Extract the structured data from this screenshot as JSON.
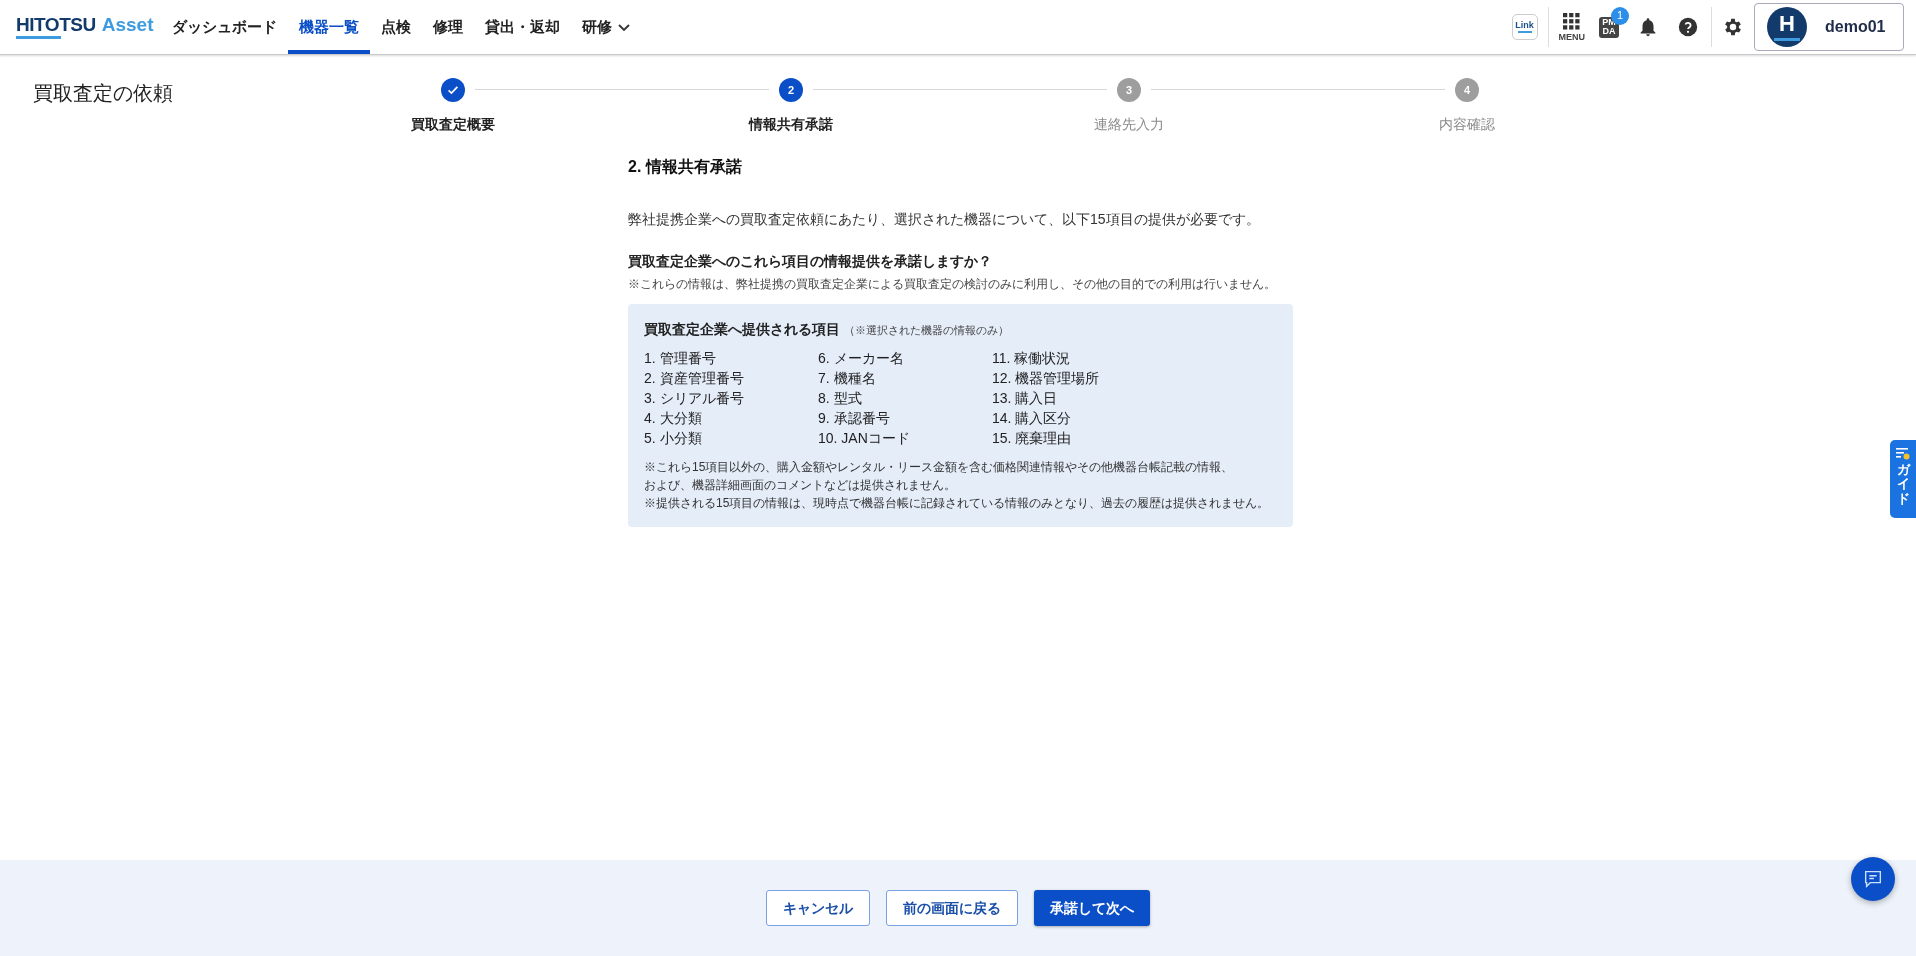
{
  "header": {
    "logo": {
      "part_1": "HITOTSU",
      "part_2": "Asset"
    },
    "nav": [
      {
        "label": "ダッシュボード",
        "selected": false,
        "has_menu": false
      },
      {
        "label": "機器一覧",
        "selected": true,
        "has_menu": false
      },
      {
        "label": "点検",
        "selected": false,
        "has_menu": false
      },
      {
        "label": "修理",
        "selected": false,
        "has_menu": false
      },
      {
        "label": "貸出・返却",
        "selected": false,
        "has_menu": false
      },
      {
        "label": "研修",
        "selected": false,
        "has_menu": true
      }
    ],
    "link_label": "Link",
    "menu_label": "MENU",
    "pmda": {
      "line_1": "PM",
      "line_2": "DA",
      "badge": "1"
    },
    "user": {
      "initial": "H",
      "name": "demo01"
    }
  },
  "page_title": "買取査定の依頼",
  "steps": [
    {
      "label": "買取査定概要",
      "completed": true,
      "selected": false
    },
    {
      "label": "情報共有承諾",
      "number": "2",
      "completed": false,
      "selected": true
    },
    {
      "label": "連絡先入力",
      "number": "3",
      "completed": false,
      "selected": false
    },
    {
      "label": "内容確認",
      "number": "4",
      "completed": false,
      "selected": false
    }
  ],
  "section_title": "2. 情報共有承諾",
  "intro": "弊社提携企業への買取査定依頼にあたり、選択された機器について、以下15項目の提供が必要です。",
  "question": "買取査定企業へのこれら項目の情報提供を承諾しますか？",
  "question_note": "※これらの情報は、弊社提携の買取査定企業による買取査定の検討のみに利用し、その他の目的での利用は行いません。",
  "info_box": {
    "title": "買取査定企業へ提供される項目",
    "title_note": "（※選択された機器の情報のみ）",
    "columns": [
      [
        "1. 管理番号",
        "2. 資産管理番号",
        "3. シリアル番号",
        "4. 大分類",
        "5. 小分類"
      ],
      [
        "6. メーカー名",
        "7. 機種名",
        "8. 型式",
        "9. 承認番号",
        "10. JANコード"
      ],
      [
        "11. 稼働状況",
        "12. 機器管理場所",
        "13. 購入日",
        "14. 購入区分",
        "15. 廃棄理由"
      ]
    ],
    "notes": [
      "※これら15項目以外の、購入金額やレンタル・リース金額を含む価格関連情報やその他機器台帳記載の情報、",
      "および、機器詳細画面のコメントなどは提供されません。",
      "※提供される15項目の情報は、現時点で機器台帳に記録されている情報のみとなり、過去の履歴は提供されません。"
    ]
  },
  "guide_tab": "ガイド",
  "buttons": [
    {
      "label": "キャンセル",
      "kind": "outline"
    },
    {
      "label": "前の画面に戻る",
      "kind": "outline"
    },
    {
      "label": "承諾して次へ",
      "kind": "primary"
    }
  ]
}
